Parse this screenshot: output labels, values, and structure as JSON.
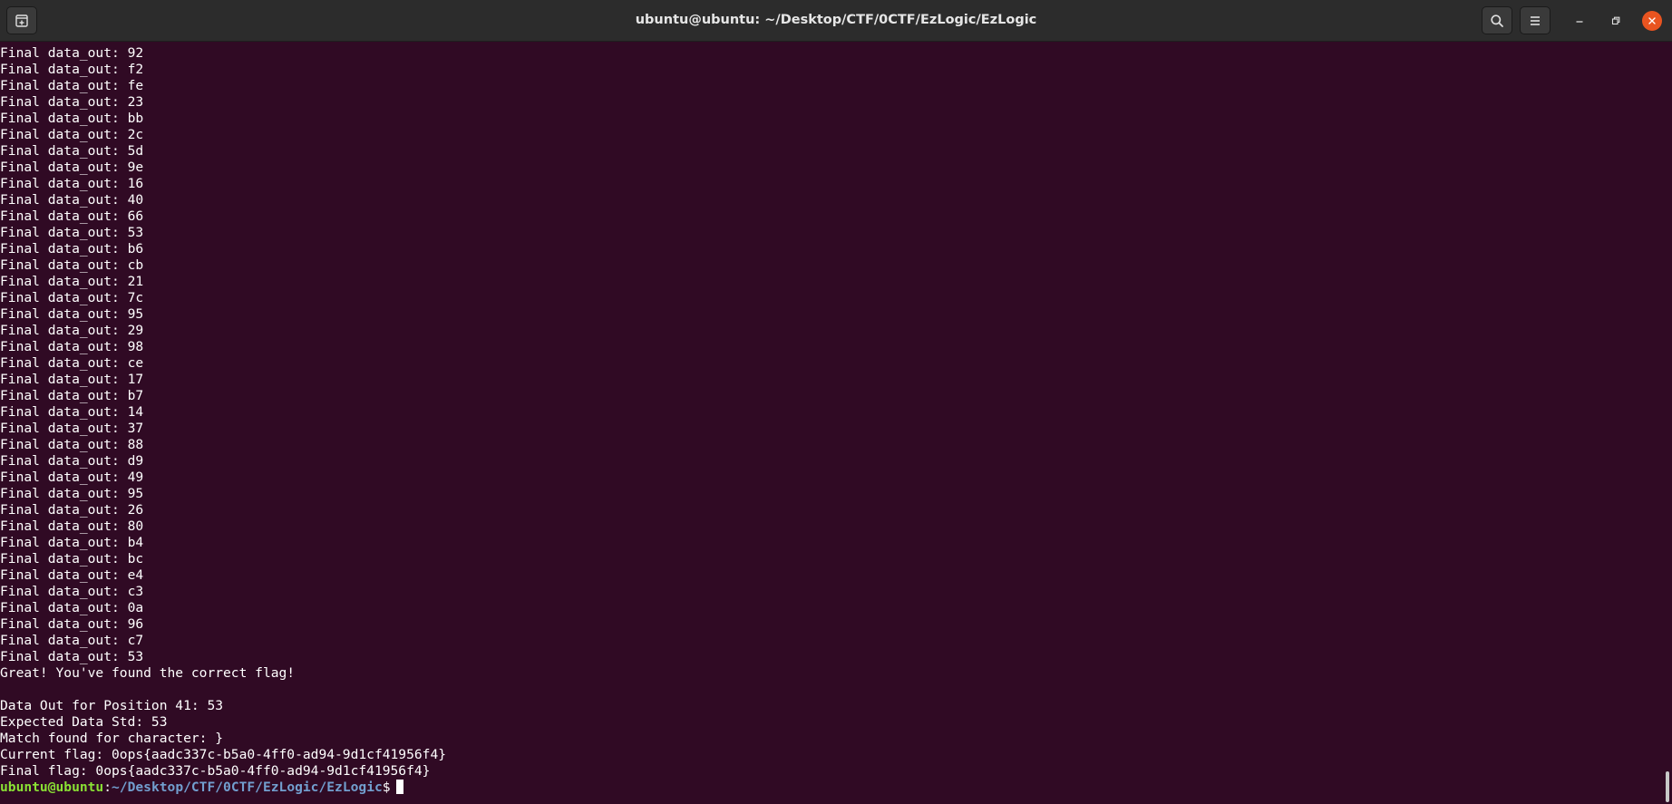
{
  "window": {
    "title": "ubuntu@ubuntu: ~/Desktop/CTF/0CTF/EzLogic/EzLogic",
    "accent_close_color": "#e95420",
    "background_color": "#300a24",
    "icons": {
      "new_tab": "new-tab-icon",
      "search": "search-icon",
      "menu": "hamburger-menu-icon",
      "minimize": "minimize-icon",
      "restore": "restore-icon",
      "close": "close-icon"
    }
  },
  "terminal": {
    "lines": [
      "Final data_out: 92",
      "Final data_out: f2",
      "Final data_out: fe",
      "Final data_out: 23",
      "Final data_out: bb",
      "Final data_out: 2c",
      "Final data_out: 5d",
      "Final data_out: 9e",
      "Final data_out: 16",
      "Final data_out: 40",
      "Final data_out: 66",
      "Final data_out: 53",
      "Final data_out: b6",
      "Final data_out: cb",
      "Final data_out: 21",
      "Final data_out: 7c",
      "Final data_out: 95",
      "Final data_out: 29",
      "Final data_out: 98",
      "Final data_out: ce",
      "Final data_out: 17",
      "Final data_out: b7",
      "Final data_out: 14",
      "Final data_out: 37",
      "Final data_out: 88",
      "Final data_out: d9",
      "Final data_out: 49",
      "Final data_out: 95",
      "Final data_out: 26",
      "Final data_out: 80",
      "Final data_out: b4",
      "Final data_out: bc",
      "Final data_out: e4",
      "Final data_out: c3",
      "Final data_out: 0a",
      "Final data_out: 96",
      "Final data_out: c7",
      "Final data_out: 53",
      "Great! You've found the correct flag!",
      "",
      "Data Out for Position 41: 53",
      "Expected Data Std: 53",
      "Match found for character: }",
      "Current flag: 0ops{aadc337c-b5a0-4ff0-ad94-9d1cf41956f4}",
      "Final flag: 0ops{aadc337c-b5a0-4ff0-ad94-9d1cf41956f4}"
    ],
    "prompt": {
      "user_host": "ubuntu@ubuntu",
      "colon": ":",
      "path": "~/Desktop/CTF/0CTF/EzLogic/EzLogic",
      "symbol": "$"
    }
  }
}
